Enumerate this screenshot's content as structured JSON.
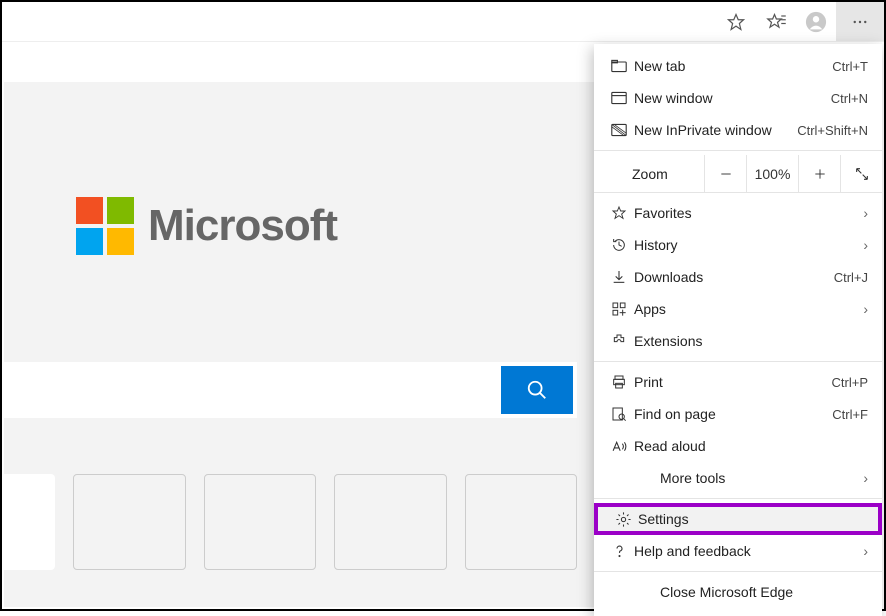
{
  "toolbar": {
    "favorite_icon": "star-icon",
    "favorites_icon": "star-sparkle-icon",
    "profile_icon": "avatar-icon",
    "more_icon": "more-dots-icon"
  },
  "brand": {
    "name": "Microsoft",
    "logo_colors": [
      "#f25022",
      "#7fba00",
      "#00a4ef",
      "#ffb900"
    ]
  },
  "search": {
    "button_label": "Search"
  },
  "menu": {
    "new_tab": {
      "label": "New tab",
      "accel": "Ctrl+T"
    },
    "new_window": {
      "label": "New window",
      "accel": "Ctrl+N"
    },
    "new_inprivate": {
      "label": "New InPrivate window",
      "accel": "Ctrl+Shift+N"
    },
    "zoom": {
      "label": "Zoom",
      "percent": "100%"
    },
    "favorites": {
      "label": "Favorites"
    },
    "history": {
      "label": "History"
    },
    "downloads": {
      "label": "Downloads",
      "accel": "Ctrl+J"
    },
    "apps": {
      "label": "Apps"
    },
    "extensions": {
      "label": "Extensions"
    },
    "print": {
      "label": "Print",
      "accel": "Ctrl+P"
    },
    "find": {
      "label": "Find on page",
      "accel": "Ctrl+F"
    },
    "read_aloud": {
      "label": "Read aloud"
    },
    "more_tools": {
      "label": "More tools"
    },
    "settings": {
      "label": "Settings"
    },
    "help": {
      "label": "Help and feedback"
    },
    "close": {
      "label": "Close Microsoft Edge"
    }
  }
}
